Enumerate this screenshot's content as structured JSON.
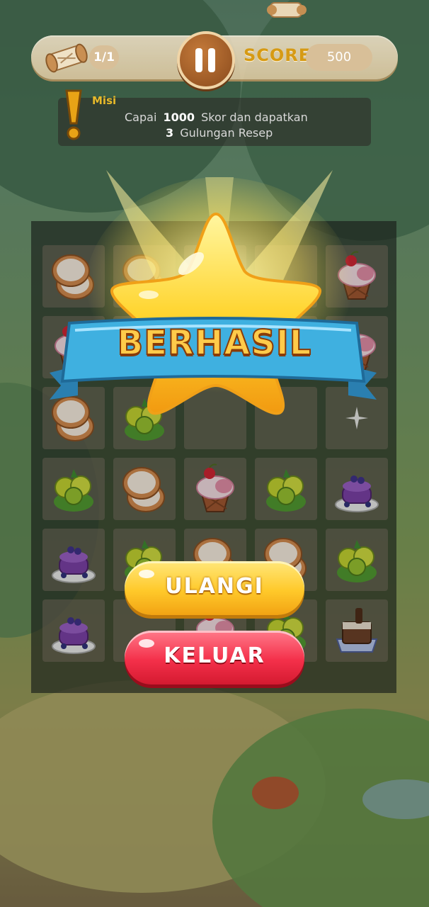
{
  "hud": {
    "scroll_count": "1/1",
    "score_label": "SCORE",
    "score_value": "500"
  },
  "mission": {
    "title": "Misi",
    "line1_prefix": "Capai",
    "score_target": "1000",
    "line1_suffix": "Skor dan dapatkan",
    "scroll_target": "3",
    "line2_suffix": "Gulungan Resep"
  },
  "result": {
    "title": "BERHASIL",
    "retry_label": "ULANGI",
    "exit_label": "KELUAR"
  },
  "board": {
    "rows": 6,
    "cols": 5,
    "tiles": [
      [
        "coconut",
        "coconut",
        "",
        "",
        "cupcake"
      ],
      [
        "cupcake",
        "",
        "",
        "",
        "cupcake"
      ],
      [
        "coconut",
        "lime",
        "",
        "",
        "sparkle"
      ],
      [
        "lime",
        "coconut",
        "cupcake",
        "lime",
        "pancake"
      ],
      [
        "pancake",
        "lime",
        "coconut",
        "coconut",
        "lime"
      ],
      [
        "pancake",
        "",
        "cupcake",
        "lime",
        "chocolate-cake"
      ]
    ]
  },
  "colors": {
    "accent_gold": "#ffc92a",
    "exit_red": "#f4304a",
    "ribbon_blue": "#3aa8d8",
    "title_orange": "#ffcb4a"
  }
}
